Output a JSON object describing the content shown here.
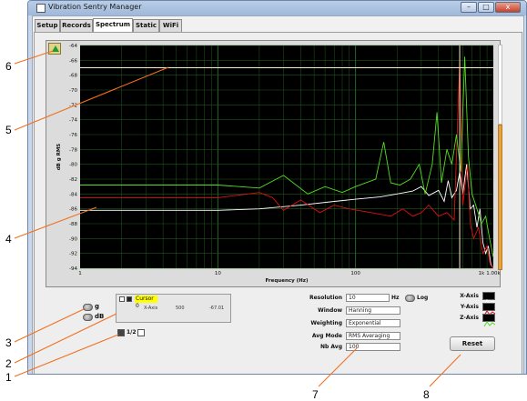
{
  "window": {
    "title": "Vibration Sentry Manager",
    "btn_min": "–",
    "btn_max": "□",
    "btn_close": "x"
  },
  "tabs": [
    {
      "label": "Setup"
    },
    {
      "label": "Records"
    },
    {
      "label": "Spectrum"
    },
    {
      "label": "Static"
    },
    {
      "label": "WiFi"
    }
  ],
  "chart_data": {
    "type": "line",
    "xlabel": "Frequency (Hz)",
    "ylabel": "dB g RMS",
    "x_scale": "log",
    "xlim": [
      1,
      1000
    ],
    "ylim": [
      -94,
      -64
    ],
    "x_ticks": [
      "1",
      "10",
      "100",
      "1k",
      "1.00k"
    ],
    "y_ticks": [
      "-64",
      "-66",
      "-68",
      "-70",
      "-72",
      "-74",
      "-76",
      "-78",
      "-80",
      "-82",
      "-84",
      "-86",
      "-88",
      "-90",
      "-92",
      "-94"
    ],
    "grid": true,
    "cursor": {
      "x": 570,
      "y": -67.0
    },
    "series": [
      {
        "name": "X-Axis",
        "color": "#ffffff",
        "points": [
          [
            1,
            -86.2
          ],
          [
            6,
            -86.2
          ],
          [
            10,
            -86.2
          ],
          [
            20,
            -86.0
          ],
          [
            40,
            -85.5
          ],
          [
            70,
            -85.0
          ],
          [
            100,
            -84.7
          ],
          [
            150,
            -84.4
          ],
          [
            200,
            -84.0
          ],
          [
            260,
            -83.6
          ],
          [
            300,
            -83.0
          ],
          [
            340,
            -84.2
          ],
          [
            400,
            -83.5
          ],
          [
            440,
            -85.0
          ],
          [
            470,
            -82.2
          ],
          [
            500,
            -84.5
          ],
          [
            540,
            -83.5
          ],
          [
            570,
            -81.0
          ],
          [
            600,
            -84.0
          ],
          [
            640,
            -80.0
          ],
          [
            680,
            -86.0
          ],
          [
            720,
            -85.5
          ],
          [
            760,
            -88.5
          ],
          [
            800,
            -86.0
          ],
          [
            840,
            -90.5
          ],
          [
            880,
            -92.0
          ],
          [
            920,
            -91.0
          ],
          [
            960,
            -93.5
          ],
          [
            1000,
            -94.0
          ]
        ]
      },
      {
        "name": "Y-Axis",
        "color": "#dd1111",
        "points": [
          [
            1,
            -84.5
          ],
          [
            8,
            -84.5
          ],
          [
            10,
            -84.5
          ],
          [
            20,
            -83.8
          ],
          [
            25,
            -84.5
          ],
          [
            30,
            -86.2
          ],
          [
            40,
            -84.8
          ],
          [
            55,
            -86.5
          ],
          [
            70,
            -85.5
          ],
          [
            90,
            -86.0
          ],
          [
            130,
            -86.5
          ],
          [
            180,
            -87.0
          ],
          [
            220,
            -86.0
          ],
          [
            260,
            -87.0
          ],
          [
            300,
            -86.5
          ],
          [
            340,
            -85.5
          ],
          [
            400,
            -87.0
          ],
          [
            460,
            -86.5
          ],
          [
            520,
            -87.5
          ],
          [
            570,
            -66.0
          ],
          [
            600,
            -85.5
          ],
          [
            650,
            -80.0
          ],
          [
            680,
            -88.0
          ],
          [
            720,
            -90.0
          ],
          [
            780,
            -88.5
          ],
          [
            840,
            -92.0
          ],
          [
            900,
            -91.0
          ],
          [
            950,
            -93.5
          ],
          [
            1000,
            -94.0
          ]
        ]
      },
      {
        "name": "Z-Axis",
        "color": "#55dd22",
        "points": [
          [
            1,
            -82.8
          ],
          [
            5,
            -82.8
          ],
          [
            10,
            -82.8
          ],
          [
            20,
            -83.2
          ],
          [
            30,
            -81.5
          ],
          [
            45,
            -84.0
          ],
          [
            60,
            -83.0
          ],
          [
            80,
            -83.8
          ],
          [
            100,
            -83.0
          ],
          [
            140,
            -82.0
          ],
          [
            160,
            -77.0
          ],
          [
            180,
            -82.5
          ],
          [
            210,
            -82.8
          ],
          [
            250,
            -82.0
          ],
          [
            290,
            -80.0
          ],
          [
            320,
            -84.0
          ],
          [
            360,
            -80.0
          ],
          [
            390,
            -73.0
          ],
          [
            420,
            -82.5
          ],
          [
            460,
            -78.0
          ],
          [
            500,
            -80.0
          ],
          [
            540,
            -76.0
          ],
          [
            580,
            -81.0
          ],
          [
            620,
            -65.5
          ],
          [
            660,
            -79.0
          ],
          [
            700,
            -84.0
          ],
          [
            760,
            -86.0
          ],
          [
            820,
            -88.0
          ],
          [
            880,
            -87.0
          ],
          [
            940,
            -90.0
          ],
          [
            1000,
            -92.5
          ]
        ]
      }
    ]
  },
  "units": {
    "label_g": "g",
    "label_db": "dB"
  },
  "cursor_panel": {
    "name": "Cursor 0",
    "axis": "X-Axis",
    "x_value": "500",
    "y_value": "-67.01"
  },
  "pager": {
    "value": "1/2"
  },
  "settings": {
    "resolution_label": "Resolution",
    "resolution_value": "10",
    "resolution_unit": "Hz",
    "log_label": "Log",
    "window_label": "Window",
    "window_value": "Hanning",
    "weighting_label": "Weighting",
    "weighting_value": "Exponential",
    "avgmode_label": "Avg Mode",
    "avgmode_value": "RMS Averaging",
    "nbavg_label": "Nb Avg",
    "nbavg_value": "100"
  },
  "legend": [
    {
      "label": "X-Axis",
      "color": "#ffffff"
    },
    {
      "label": "Y-Axis",
      "color": "#dd1111"
    },
    {
      "label": "Z-Axis",
      "color": "#55dd22"
    }
  ],
  "reset_label": "Reset",
  "callouts": [
    "1",
    "2",
    "3",
    "4",
    "5",
    "6",
    "7",
    "8"
  ],
  "colors": {
    "plot_bg": "#000000",
    "grid": "#1f5a1f",
    "callout_line": "#f07020",
    "cursor": "#f5f0c8"
  }
}
